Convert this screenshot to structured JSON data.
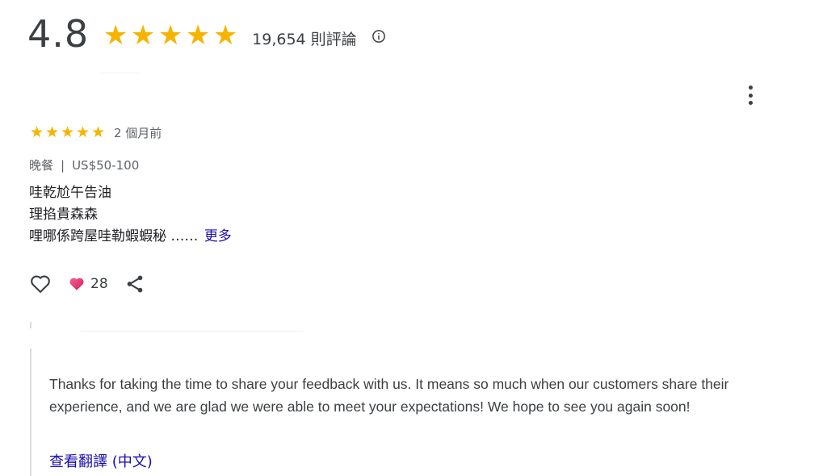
{
  "summary": {
    "rating": "4.8",
    "stars": 5,
    "review_count": "19,654 則評論",
    "info_icon": "info-icon"
  },
  "review": {
    "stars": 5,
    "time_ago": "2 個月前",
    "meal": "晚餐",
    "separator": "|",
    "price": "US$50-100",
    "lines": [
      "哇乾尬午告油",
      "理掐貴森森",
      "哩哪係跨屋哇勒蝦蝦秘 ……"
    ],
    "more_label": "更多",
    "likes": "28",
    "icons": [
      "like-heart-outline-icon",
      "heart-reaction-icon",
      "share-icon",
      "more-vert-icon"
    ]
  },
  "reply": {
    "text": "Thanks for taking the time to share your feedback with us. It means so much when our customers share their experience, and we are glad we were able to meet your expectations! We hope to see you again soon!",
    "translate_label": "查看翻譯 (中文)"
  },
  "colors": {
    "star": "#f6b400",
    "link": "#1a0dab",
    "text": "#3c4043",
    "heart": "#e8316b",
    "border": "#dadce0"
  }
}
